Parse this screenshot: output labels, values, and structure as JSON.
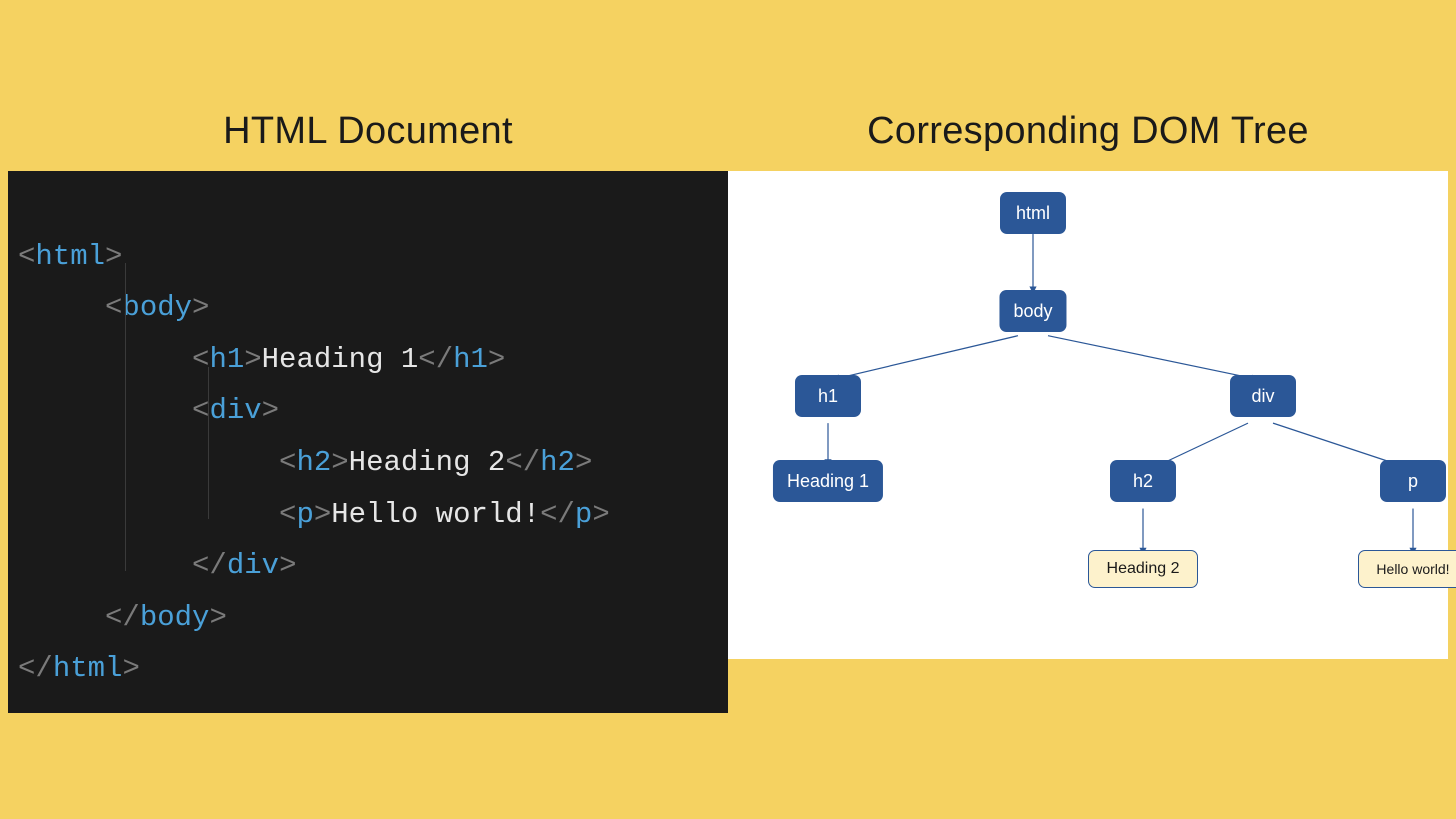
{
  "left": {
    "title": "HTML Document",
    "code": {
      "line1_tag": "html",
      "line2_tag": "body",
      "line3_tag": "h1",
      "line3_text": "Heading 1",
      "line4_tag": "div",
      "line5_tag": "h2",
      "line5_text": "Heading 2",
      "line6_tag": "p",
      "line6_text": "Hello world!",
      "line7_tag": "div",
      "line8_tag": "body",
      "line9_tag": "html"
    }
  },
  "right": {
    "title": "Corresponding DOM Tree",
    "nodes": {
      "html": "html",
      "body": "body",
      "h1": "h1",
      "div": "div",
      "h2": "h2",
      "p": "p",
      "heading1": "Heading 1",
      "heading2": "Heading 2",
      "hello": "Hello world!"
    }
  }
}
